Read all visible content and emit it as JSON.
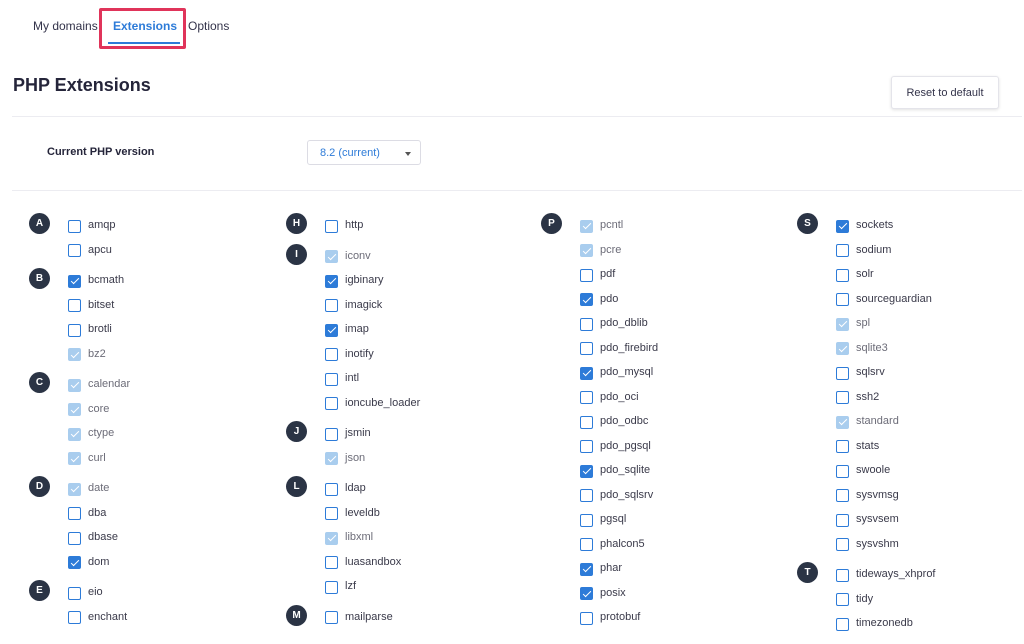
{
  "tabs": [
    {
      "label": "My domains",
      "active": false
    },
    {
      "label": "Extensions",
      "active": true
    },
    {
      "label": "Options",
      "active": false
    }
  ],
  "page_title": "PHP Extensions",
  "reset_button": "Reset to default",
  "php_version": {
    "label": "Current PHP version",
    "selected": "8.2 (current)"
  },
  "colors": {
    "accent": "#2d7bd8",
    "highlight": "#e0345a",
    "badge": "#2b3445",
    "disabled": "#a9cdee"
  },
  "columns": [
    [
      {
        "letter": "A",
        "items": [
          {
            "name": "amqp",
            "state": "unchecked"
          },
          {
            "name": "apcu",
            "state": "unchecked"
          }
        ]
      },
      {
        "letter": "B",
        "items": [
          {
            "name": "bcmath",
            "state": "checked"
          },
          {
            "name": "bitset",
            "state": "unchecked"
          },
          {
            "name": "brotli",
            "state": "unchecked"
          },
          {
            "name": "bz2",
            "state": "disabled"
          }
        ]
      },
      {
        "letter": "C",
        "items": [
          {
            "name": "calendar",
            "state": "disabled"
          },
          {
            "name": "core",
            "state": "disabled"
          },
          {
            "name": "ctype",
            "state": "disabled"
          },
          {
            "name": "curl",
            "state": "disabled"
          }
        ]
      },
      {
        "letter": "D",
        "items": [
          {
            "name": "date",
            "state": "disabled"
          },
          {
            "name": "dba",
            "state": "unchecked"
          },
          {
            "name": "dbase",
            "state": "unchecked"
          },
          {
            "name": "dom",
            "state": "checked"
          }
        ]
      },
      {
        "letter": "E",
        "items": [
          {
            "name": "eio",
            "state": "unchecked"
          },
          {
            "name": "enchant",
            "state": "unchecked"
          }
        ]
      }
    ],
    [
      {
        "letter": "H",
        "items": [
          {
            "name": "http",
            "state": "unchecked"
          }
        ]
      },
      {
        "letter": "I",
        "items": [
          {
            "name": "iconv",
            "state": "disabled"
          },
          {
            "name": "igbinary",
            "state": "checked"
          },
          {
            "name": "imagick",
            "state": "unchecked"
          },
          {
            "name": "imap",
            "state": "checked"
          },
          {
            "name": "inotify",
            "state": "unchecked"
          },
          {
            "name": "intl",
            "state": "unchecked"
          },
          {
            "name": "ioncube_loader",
            "state": "unchecked"
          }
        ]
      },
      {
        "letter": "J",
        "items": [
          {
            "name": "jsmin",
            "state": "unchecked"
          },
          {
            "name": "json",
            "state": "disabled"
          }
        ]
      },
      {
        "letter": "L",
        "items": [
          {
            "name": "ldap",
            "state": "unchecked"
          },
          {
            "name": "leveldb",
            "state": "unchecked"
          },
          {
            "name": "libxml",
            "state": "disabled"
          },
          {
            "name": "luasandbox",
            "state": "unchecked"
          },
          {
            "name": "lzf",
            "state": "unchecked"
          }
        ]
      },
      {
        "letter": "M",
        "items": [
          {
            "name": "mailparse",
            "state": "unchecked"
          }
        ]
      }
    ],
    [
      {
        "letter": "P",
        "items": [
          {
            "name": "pcntl",
            "state": "disabled"
          },
          {
            "name": "pcre",
            "state": "disabled"
          },
          {
            "name": "pdf",
            "state": "unchecked"
          },
          {
            "name": "pdo",
            "state": "checked"
          },
          {
            "name": "pdo_dblib",
            "state": "unchecked"
          },
          {
            "name": "pdo_firebird",
            "state": "unchecked"
          },
          {
            "name": "pdo_mysql",
            "state": "checked"
          },
          {
            "name": "pdo_oci",
            "state": "unchecked"
          },
          {
            "name": "pdo_odbc",
            "state": "unchecked"
          },
          {
            "name": "pdo_pgsql",
            "state": "unchecked"
          },
          {
            "name": "pdo_sqlite",
            "state": "checked"
          },
          {
            "name": "pdo_sqlsrv",
            "state": "unchecked"
          },
          {
            "name": "pgsql",
            "state": "unchecked"
          },
          {
            "name": "phalcon5",
            "state": "unchecked"
          },
          {
            "name": "phar",
            "state": "checked"
          },
          {
            "name": "posix",
            "state": "checked"
          },
          {
            "name": "protobuf",
            "state": "unchecked"
          }
        ]
      }
    ],
    [
      {
        "letter": "S",
        "items": [
          {
            "name": "sockets",
            "state": "checked"
          },
          {
            "name": "sodium",
            "state": "unchecked"
          },
          {
            "name": "solr",
            "state": "unchecked"
          },
          {
            "name": "sourceguardian",
            "state": "unchecked"
          },
          {
            "name": "spl",
            "state": "disabled"
          },
          {
            "name": "sqlite3",
            "state": "disabled"
          },
          {
            "name": "sqlsrv",
            "state": "unchecked"
          },
          {
            "name": "ssh2",
            "state": "unchecked"
          },
          {
            "name": "standard",
            "state": "disabled"
          },
          {
            "name": "stats",
            "state": "unchecked"
          },
          {
            "name": "swoole",
            "state": "unchecked"
          },
          {
            "name": "sysvmsg",
            "state": "unchecked"
          },
          {
            "name": "sysvsem",
            "state": "unchecked"
          },
          {
            "name": "sysvshm",
            "state": "unchecked"
          }
        ]
      },
      {
        "letter": "T",
        "items": [
          {
            "name": "tideways_xhprof",
            "state": "unchecked"
          },
          {
            "name": "tidy",
            "state": "unchecked"
          },
          {
            "name": "timezonedb",
            "state": "unchecked"
          }
        ]
      }
    ]
  ]
}
